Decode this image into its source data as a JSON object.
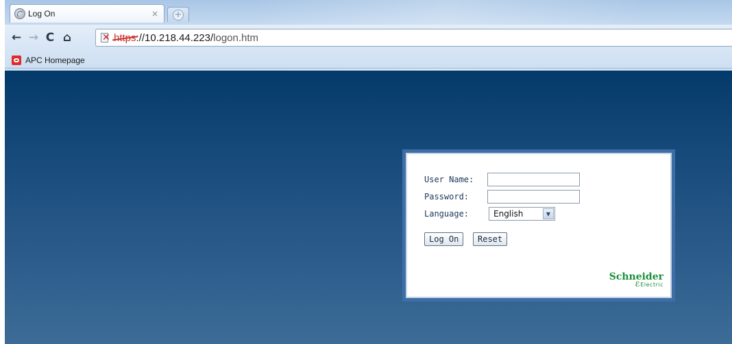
{
  "browser": {
    "tab": {
      "title": "Log On",
      "close_glyph": "×",
      "globe_icon": "globe-icon"
    },
    "new_tab_glyph": "+",
    "nav": {
      "back_glyph": "←",
      "forward_glyph": "→",
      "reload_glyph": "C",
      "home_glyph": "⌂"
    },
    "address": {
      "scheme": "https",
      "host_rest": "://10.218.44.223/",
      "path": "logon.htm"
    },
    "bookmarks": [
      {
        "label": "APC Homepage",
        "icon": "apc-icon"
      }
    ]
  },
  "login": {
    "username_label": "User Name:",
    "username_value": "",
    "password_label": "Password:",
    "password_value": "",
    "language_label": "Language:",
    "language_selected": "English",
    "language_arrow": "▼",
    "logon_button": "Log On",
    "reset_button": "Reset"
  },
  "brand": {
    "name": "Schneider",
    "sub": "Electric"
  },
  "colors": {
    "page_bg_top": "#043a6a",
    "page_bg_bottom": "#3d6c97",
    "panel_border": "#3d6fa6",
    "brand_green": "#1a8f3a",
    "scheme_error_red": "#c8322f"
  }
}
